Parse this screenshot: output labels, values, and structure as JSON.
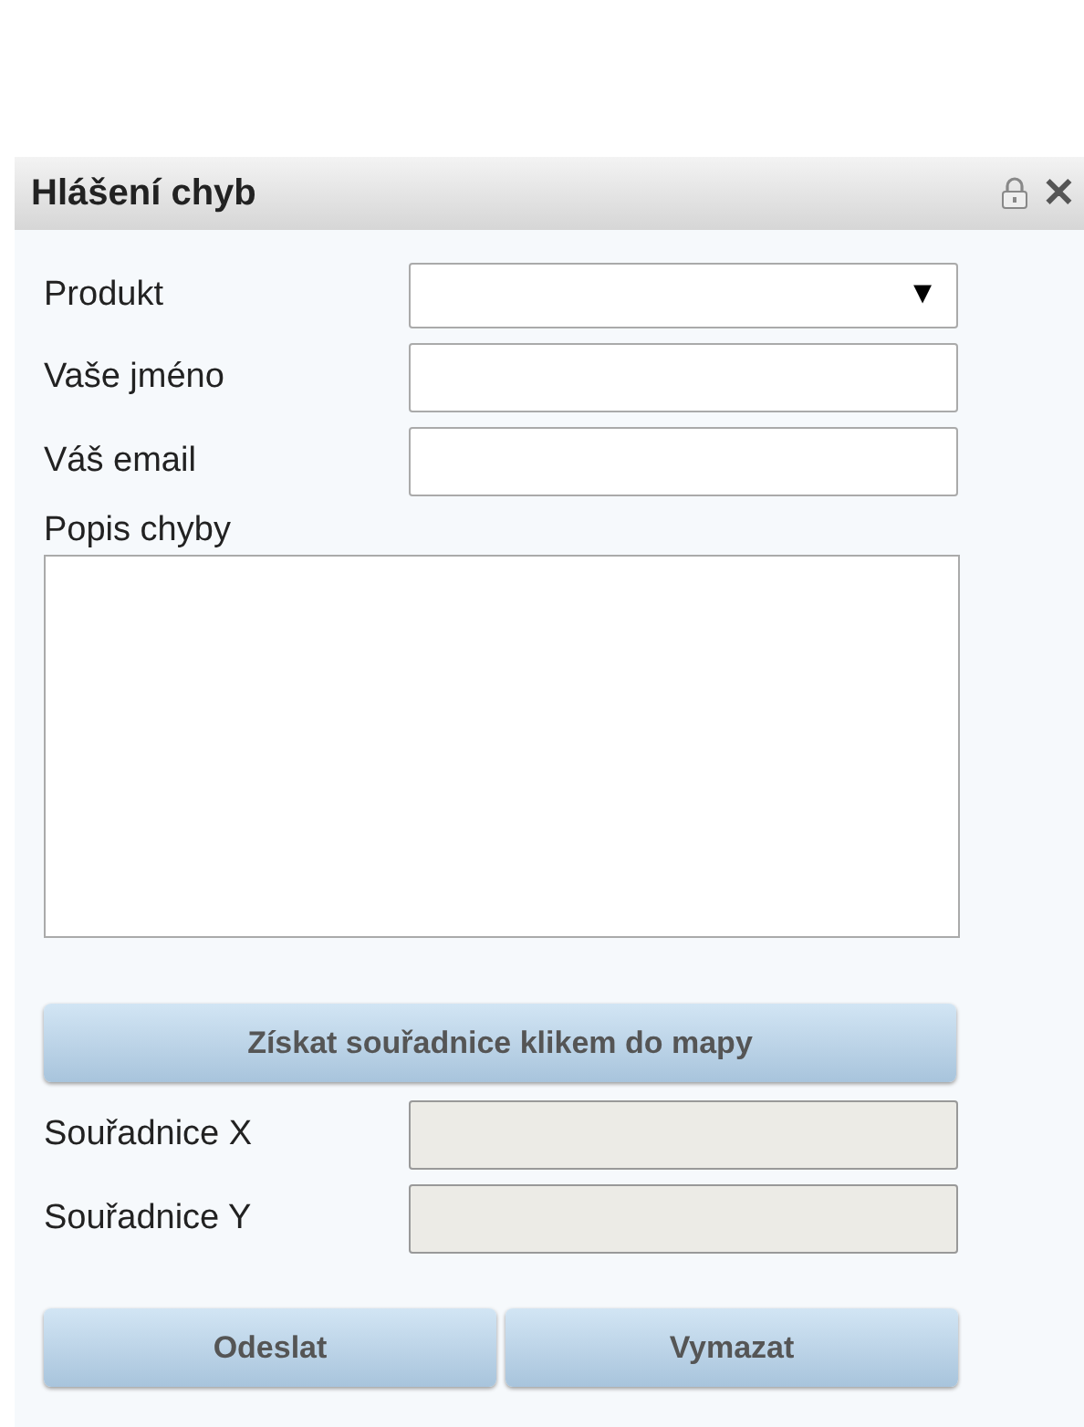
{
  "window": {
    "title": "Hlášení chyb",
    "close": "✕"
  },
  "fields": [
    {
      "kind": "select",
      "label": "Produkt",
      "arrow": "▼",
      "disabled": false
    },
    {
      "kind": "text",
      "label": "Vaše jméno",
      "disabled": false
    },
    {
      "kind": "text",
      "label": "Váš email",
      "disabled": false
    },
    {
      "kind": "textarea",
      "label": "Popis chyby",
      "disabled": false
    }
  ],
  "map_button": "Získat souřadnice klikem do mapy",
  "coordinates": [
    {
      "label": "Souřadnice X",
      "disabled": true
    },
    {
      "label": "Souřadnice Y",
      "disabled": true
    }
  ],
  "buttons": [
    "Odeslat",
    "Vymazat"
  ]
}
